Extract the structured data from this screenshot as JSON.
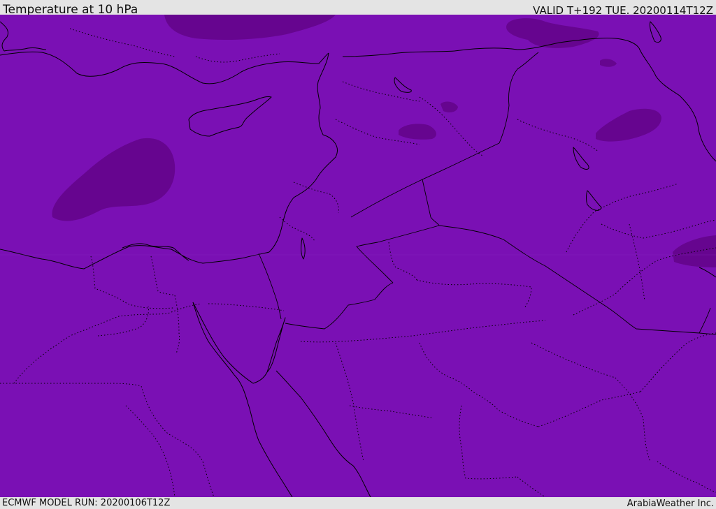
{
  "header": {
    "title": "Temperature at 10 hPa",
    "valid": "VALID T+192 TUE. 20200114T12Z"
  },
  "footer": {
    "model_run": "ECMWF MODEL RUN: 20200106T12Z",
    "credit": "ArabiaWeather Inc."
  },
  "map": {
    "colors": {
      "field": "#7a10b4",
      "cold_patch": "#66058f",
      "coast": "#000000",
      "frame": "#e4e4e4"
    }
  }
}
